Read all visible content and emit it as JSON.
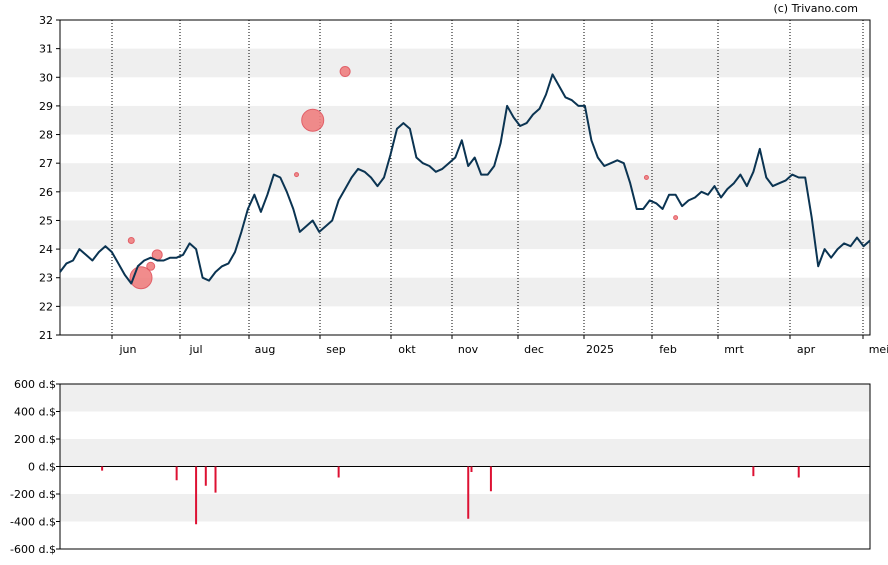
{
  "copyright": "(c) Trivano.com",
  "colors": {
    "price_line": "#0b3452",
    "event_marker": "#f08080",
    "event_marker_edge": "#e0505a",
    "volume_bar": "#dd1133",
    "band": "#efefef",
    "axis": "#000000"
  },
  "chart_data": [
    {
      "type": "line",
      "name": "price",
      "x_months": [
        "jun",
        "jul",
        "aug",
        "sep",
        "okt",
        "nov",
        "dec",
        "2025",
        "feb",
        "mrt",
        "apr",
        "mei"
      ],
      "y_ticks": [
        "21",
        "22",
        "23",
        "24",
        "25",
        "26",
        "27",
        "28",
        "29",
        "30",
        "31",
        "32"
      ],
      "ylim": [
        21,
        32
      ],
      "xlim": [
        0,
        250
      ],
      "grid": "vertical dotted at month starts, alternating horizontal bands",
      "series_x_units": "trading days from start",
      "x": [
        0,
        2,
        4,
        6,
        8,
        10,
        12,
        14,
        16,
        18,
        20,
        22,
        24,
        26,
        28,
        30,
        32,
        34,
        36,
        38,
        40,
        42,
        44,
        46,
        48,
        50,
        52,
        54,
        56,
        58,
        60,
        62,
        64,
        66,
        68,
        70,
        72,
        74,
        76,
        78,
        80,
        82,
        84,
        86,
        88,
        90,
        92,
        94,
        96,
        98,
        100,
        102,
        104,
        106,
        108,
        110,
        112,
        114,
        116,
        118,
        120,
        122,
        124,
        126,
        128,
        130,
        132,
        134,
        136,
        138,
        140,
        142,
        144,
        146,
        148,
        150,
        152,
        154,
        156,
        158,
        160,
        162,
        164,
        166,
        168,
        170,
        172,
        174,
        176,
        178,
        180,
        182,
        184,
        186,
        188,
        190,
        192,
        194,
        196,
        198,
        200,
        202,
        204,
        206,
        208,
        210,
        212,
        214,
        216,
        218,
        220,
        222,
        224,
        226,
        228,
        230,
        232,
        234,
        236,
        238,
        240,
        242,
        244,
        246,
        248,
        250
      ],
      "values": [
        23.2,
        23.5,
        23.6,
        24.0,
        23.8,
        23.6,
        23.9,
        24.1,
        23.9,
        23.5,
        23.1,
        22.8,
        23.4,
        23.6,
        23.7,
        23.6,
        23.6,
        23.7,
        23.7,
        23.8,
        24.2,
        24.0,
        23.0,
        22.9,
        23.2,
        23.4,
        23.5,
        23.9,
        24.6,
        25.4,
        25.9,
        25.3,
        25.9,
        26.6,
        26.5,
        26.0,
        25.4,
        24.6,
        24.8,
        25.0,
        24.6,
        24.8,
        25.0,
        25.7,
        26.1,
        26.5,
        26.8,
        26.7,
        26.5,
        26.2,
        26.5,
        27.3,
        28.2,
        28.4,
        28.2,
        27.2,
        27.0,
        26.9,
        26.7,
        26.8,
        27.0,
        27.2,
        27.8,
        26.9,
        27.2,
        26.6,
        26.6,
        26.9,
        27.7,
        29.0,
        28.6,
        28.3,
        28.4,
        28.7,
        28.9,
        29.4,
        30.1,
        29.7,
        29.3,
        29.2,
        29.0,
        29.0,
        27.8,
        27.2,
        26.9,
        27.0,
        27.1,
        27.0,
        26.3,
        25.4,
        25.4,
        25.7,
        25.6,
        25.4,
        25.9,
        25.9,
        25.5,
        25.7,
        25.8,
        26.0,
        25.9,
        26.2,
        25.8,
        26.1,
        26.3,
        26.6,
        26.2,
        26.7,
        27.5,
        26.5,
        26.2,
        26.3,
        26.4,
        26.6,
        26.5,
        26.5,
        25.1,
        23.4,
        24.0,
        23.7,
        24.0,
        24.2,
        24.1,
        24.4,
        24.1,
        24.3,
        24.4,
        24.5
      ],
      "events": [
        {
          "x": 22,
          "y": 24.3,
          "size": 3
        },
        {
          "x": 25,
          "y": 23.0,
          "size": 11
        },
        {
          "x": 28,
          "y": 23.4,
          "size": 4
        },
        {
          "x": 30,
          "y": 23.8,
          "size": 5
        },
        {
          "x": 73,
          "y": 26.6,
          "size": 2
        },
        {
          "x": 78,
          "y": 28.5,
          "size": 11
        },
        {
          "x": 88,
          "y": 30.2,
          "size": 5
        },
        {
          "x": 181,
          "y": 26.5,
          "size": 2
        },
        {
          "x": 190,
          "y": 25.1,
          "size": 2
        }
      ]
    },
    {
      "type": "bar",
      "name": "net-transactions",
      "y_ticks": [
        "600 d.$",
        "400 d.$",
        "200 d.$",
        "0 d.$",
        "-200 d.$",
        "-400 d.$",
        "-600 d.$"
      ],
      "ylim": [
        -600,
        600
      ],
      "bars": [
        {
          "x": 13,
          "value": -30
        },
        {
          "x": 36,
          "value": -100
        },
        {
          "x": 42,
          "value": -420
        },
        {
          "x": 45,
          "value": -140
        },
        {
          "x": 48,
          "value": -190
        },
        {
          "x": 86,
          "value": -80
        },
        {
          "x": 126,
          "value": -380
        },
        {
          "x": 127,
          "value": -40
        },
        {
          "x": 133,
          "value": -180
        },
        {
          "x": 214,
          "value": -70
        },
        {
          "x": 228,
          "value": -80
        }
      ]
    }
  ]
}
